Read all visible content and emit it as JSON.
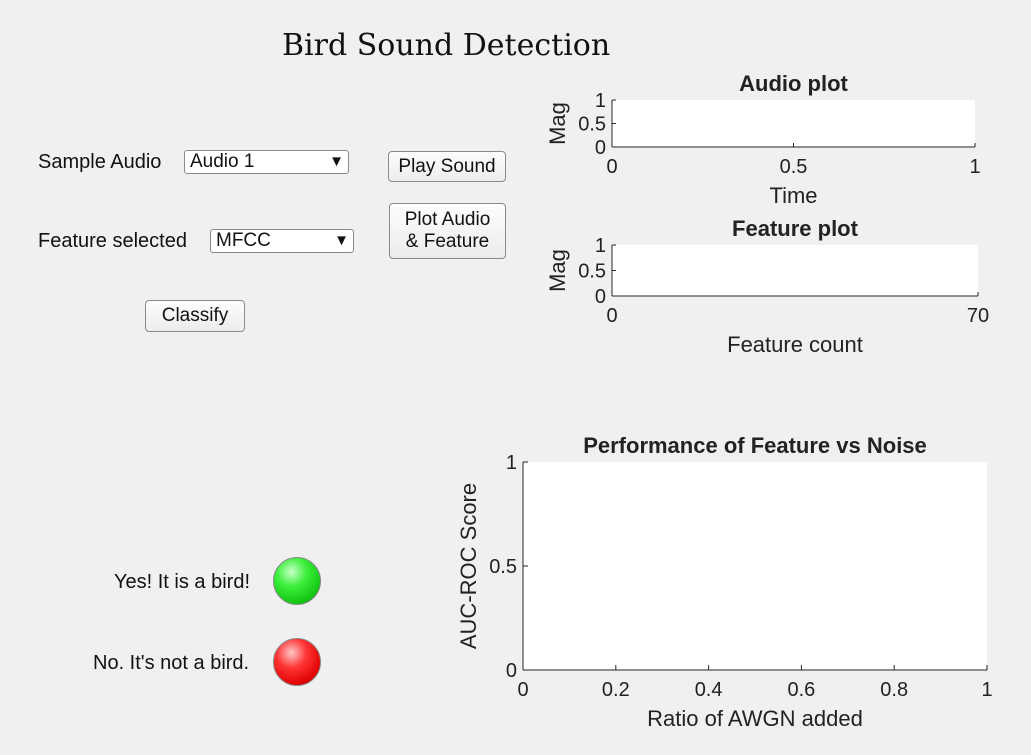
{
  "app": {
    "title": "Bird Sound Detection"
  },
  "controls": {
    "sample_audio_label": "Sample Audio",
    "sample_audio_value": "Audio 1",
    "feature_label": "Feature selected",
    "feature_value": "MFCC",
    "play_button": "Play Sound",
    "plot_button_line1": "Plot Audio",
    "plot_button_line2": "& Feature",
    "classify_button": "Classify"
  },
  "results": {
    "yes_label": "Yes! It is a bird!",
    "no_label": "No. It's not a bird.",
    "yes_color": "#22dd22",
    "no_color": "#ee1111"
  },
  "chart_data": [
    {
      "type": "line",
      "title": "Audio plot",
      "xlabel": "Time",
      "ylabel": "Mag",
      "xlim": [
        0,
        1
      ],
      "ylim": [
        0,
        1
      ],
      "xticks": [
        "0",
        "0.5",
        "1"
      ],
      "yticks": [
        "0",
        "0.5",
        "1"
      ],
      "series": []
    },
    {
      "type": "line",
      "title": "Feature plot",
      "xlabel": "Feature count",
      "ylabel": "Mag",
      "xlim": [
        0,
        70
      ],
      "ylim": [
        0,
        1
      ],
      "xticks": [
        "0",
        "70"
      ],
      "yticks": [
        "0",
        "0.5",
        "1"
      ],
      "series": []
    },
    {
      "type": "line",
      "title": "Performance of Feature vs Noise",
      "xlabel": "Ratio of AWGN added",
      "ylabel": "AUC-ROC Score",
      "xlim": [
        0,
        1
      ],
      "ylim": [
        0,
        1
      ],
      "xticks": [
        "0",
        "0.2",
        "0.4",
        "0.6",
        "0.8",
        "1"
      ],
      "yticks": [
        "0",
        "0.5",
        "1"
      ],
      "series": []
    }
  ]
}
